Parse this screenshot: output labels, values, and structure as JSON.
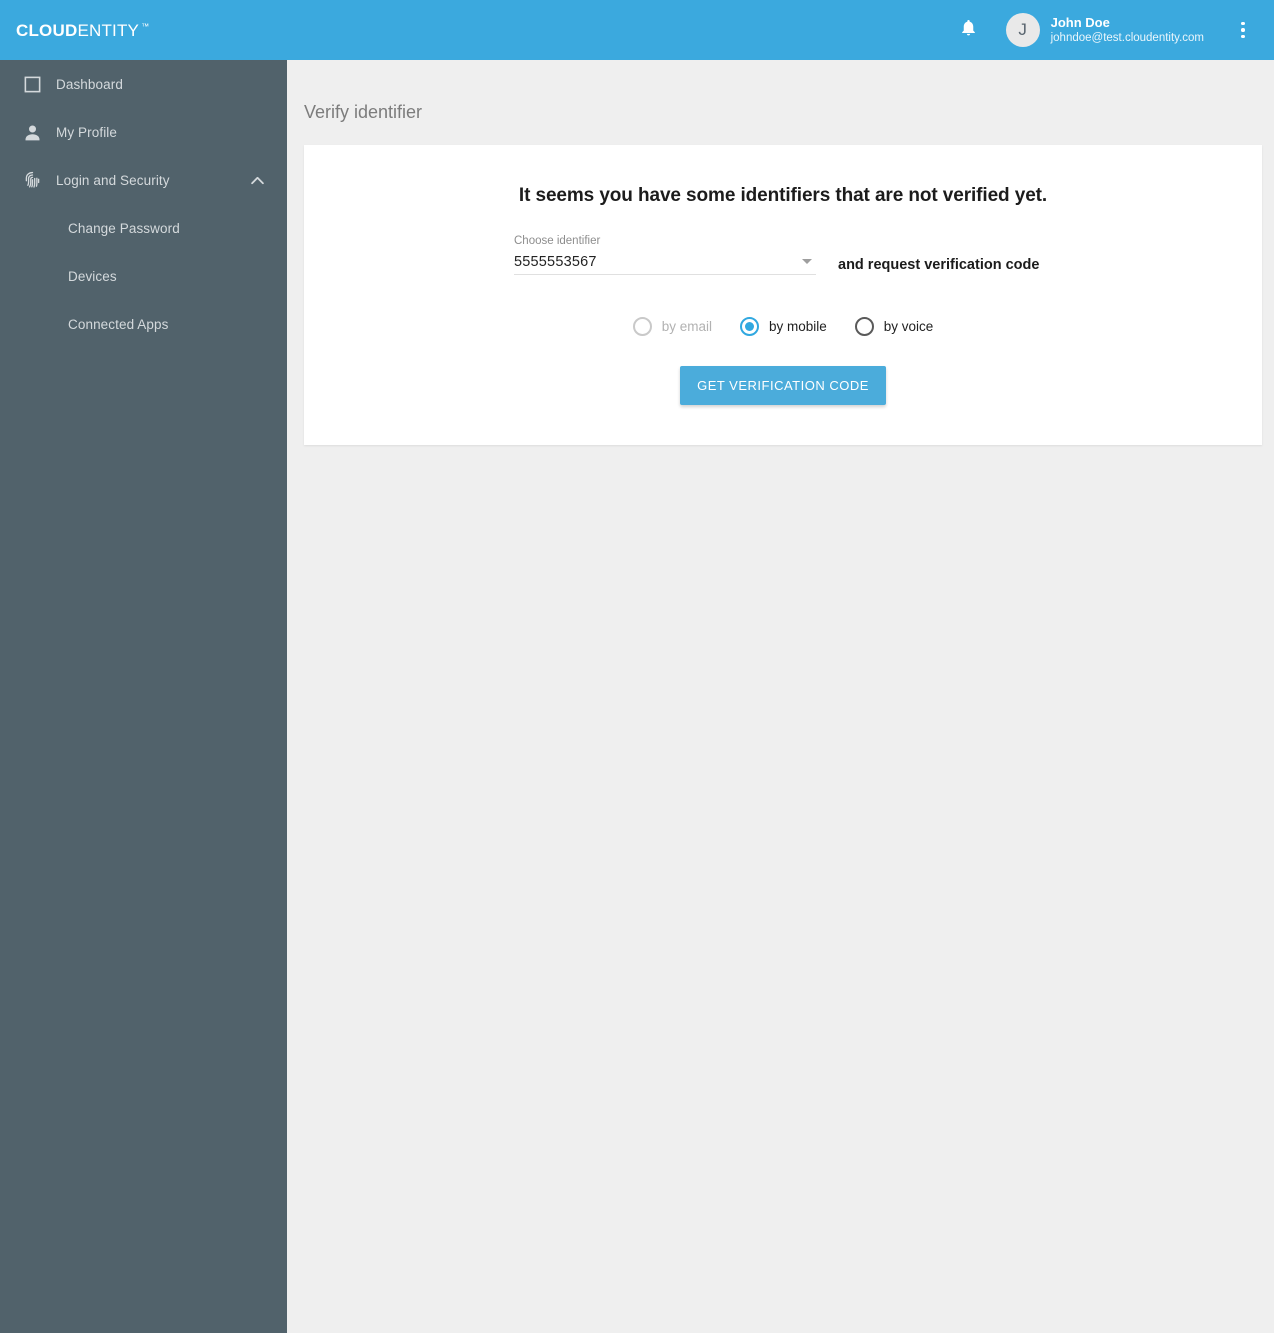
{
  "header": {
    "logo_strong": "CLOUD",
    "logo_light": "ENTITY",
    "logo_tm": "™",
    "bell_icon": "bell-icon",
    "avatar_initial": "J",
    "user_name": "John Doe",
    "user_email": "johndoe@test.cloudentity.com",
    "kebab_icon": "more-vertical-icon",
    "background_color": "#3ba9de"
  },
  "sidebar": {
    "background_color": "#51626b",
    "items": [
      {
        "label": "Dashboard",
        "icon": "square-outline-icon"
      },
      {
        "label": "My Profile",
        "icon": "person-icon"
      },
      {
        "label": "Login and Security",
        "icon": "fingerprint-icon",
        "chevron": "chevron-up-icon",
        "expanded": true
      }
    ],
    "sub_items": [
      {
        "label": "Change Password"
      },
      {
        "label": "Devices"
      },
      {
        "label": "Connected Apps"
      }
    ]
  },
  "main": {
    "page_title": "Verify identifier",
    "card": {
      "heading": "It seems you have some identifiers that are not verified yet.",
      "select": {
        "label": "Choose identifier",
        "value": "5555553567",
        "arrow_icon": "chevron-down-icon"
      },
      "suffix_text": "and request verification code",
      "radios": [
        {
          "label": "by email",
          "selected": false,
          "disabled": true
        },
        {
          "label": "by mobile",
          "selected": true,
          "disabled": false
        },
        {
          "label": "by voice",
          "selected": false,
          "disabled": false
        }
      ],
      "submit_label": "GET VERIFICATION CODE",
      "accent_color": "#4bacdb"
    }
  }
}
